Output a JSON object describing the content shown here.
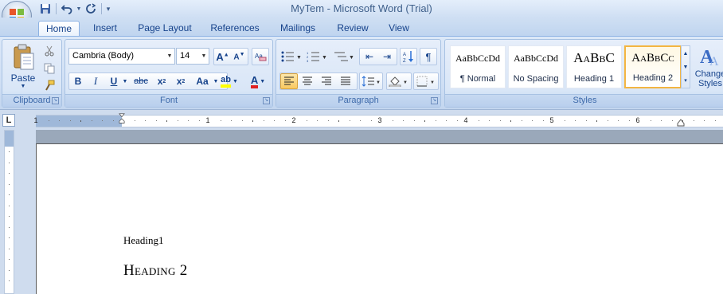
{
  "window": {
    "title": "MyTem - Microsoft Word (Trial)"
  },
  "qat": {
    "save_icon": "save-icon",
    "undo_icon": "undo-icon",
    "redo_icon": "redo-icon",
    "customize_icon": "customize-icon"
  },
  "tabs": [
    {
      "label": "Home",
      "active": true
    },
    {
      "label": "Insert"
    },
    {
      "label": "Page Layout"
    },
    {
      "label": "References"
    },
    {
      "label": "Mailings"
    },
    {
      "label": "Review"
    },
    {
      "label": "View"
    }
  ],
  "clipboard": {
    "group_label": "Clipboard",
    "paste_label": "Paste"
  },
  "font": {
    "group_label": "Font",
    "family": "Cambria (Body)",
    "size": "14",
    "grow": "A",
    "shrink": "A",
    "bold": "B",
    "italic": "I",
    "underline": "U",
    "strike": "abc",
    "subscript": "x",
    "superscript": "x",
    "case": "Aa",
    "highlight": "ab",
    "color": "A"
  },
  "paragraph": {
    "group_label": "Paragraph"
  },
  "styles": {
    "group_label": "Styles",
    "items": [
      {
        "sample": "AaBbCcDd",
        "name": "¶ Normal"
      },
      {
        "sample": "AaBbCcDd",
        "name": "No Spacing"
      },
      {
        "sample": "AaBbC",
        "name": "Heading 1"
      },
      {
        "sample": "AaBbCc",
        "name": "Heading 2",
        "selected": true
      }
    ],
    "change_label_1": "Change",
    "change_label_2": "Styles"
  },
  "ruler": {
    "numbers": [
      "1",
      "1",
      "2",
      "3",
      "4",
      "5",
      "6"
    ]
  },
  "document": {
    "line1": "Heading1",
    "line2": "Heading 2"
  },
  "colors": {
    "accent": "#15428b",
    "selected_style_border": "#f3b541"
  }
}
